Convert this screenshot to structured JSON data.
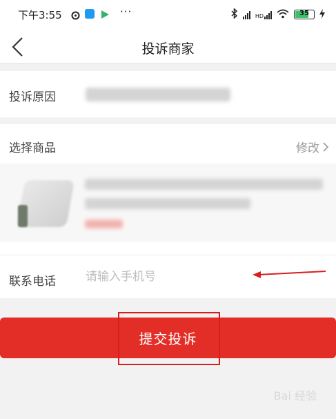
{
  "status_bar": {
    "time": "下午3:55",
    "more": "···",
    "battery": "35",
    "signal_label_1": "HD",
    "signal_label_2": "HD"
  },
  "nav": {
    "title": "投诉商家"
  },
  "form": {
    "reason_label": "投诉原因",
    "product_label": "选择商品",
    "edit_label": "修改",
    "phone_label": "联系电话",
    "phone_placeholder": "请输入手机号"
  },
  "submit": {
    "label": "提交投诉"
  },
  "watermark": "Bai 经验",
  "colors": {
    "accent": "#e22e27",
    "annotation": "#d81e1e"
  }
}
